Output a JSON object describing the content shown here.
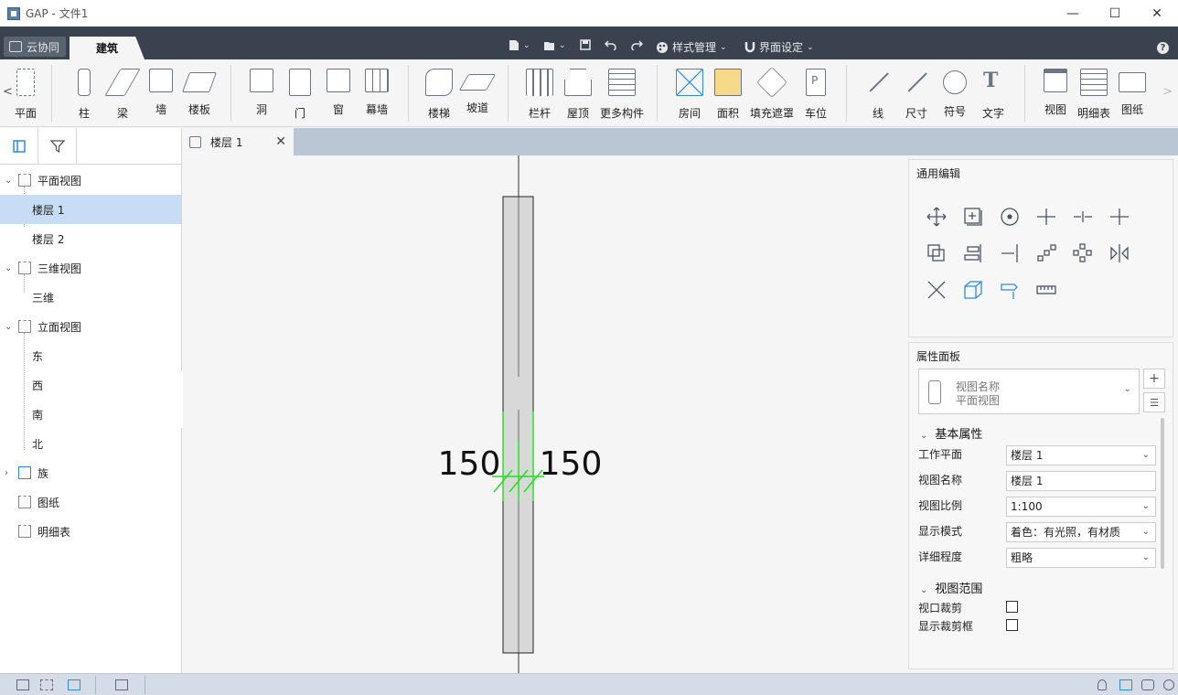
{
  "window": {
    "title": "GAP - 文件1",
    "minimize": "—",
    "maximize": "☐",
    "close": "✕"
  },
  "menubar": {
    "cloud_label": "云协同",
    "active_tab": "建筑",
    "style_manage": "样式管理",
    "ui_settings": "界面设定",
    "help": "?"
  },
  "ribbon": {
    "scroll_left": "<",
    "scroll_right": ">",
    "items": [
      {
        "label": "平面",
        "icon": "plan-icon"
      },
      {
        "label": "柱",
        "icon": "column-icon"
      },
      {
        "label": "梁",
        "icon": "beam-icon"
      },
      {
        "label": "墙",
        "icon": "wall-icon"
      },
      {
        "label": "楼板",
        "icon": "floor-slab-icon"
      },
      {
        "label": "洞",
        "icon": "opening-icon"
      },
      {
        "label": "门",
        "icon": "door-icon"
      },
      {
        "label": "窗",
        "icon": "window-icon"
      },
      {
        "label": "幕墙",
        "icon": "curtain-wall-icon"
      },
      {
        "label": "楼梯",
        "icon": "stairs-icon"
      },
      {
        "label": "坡道",
        "icon": "ramp-icon"
      },
      {
        "label": "栏杆",
        "icon": "railing-icon"
      },
      {
        "label": "屋顶",
        "icon": "roof-icon"
      },
      {
        "label": "更多构件",
        "icon": "more-components-icon"
      },
      {
        "label": "房间",
        "icon": "room-icon"
      },
      {
        "label": "面积",
        "icon": "area-icon"
      },
      {
        "label": "填充遮罩",
        "icon": "fill-mask-icon"
      },
      {
        "label": "车位",
        "icon": "parking-icon"
      },
      {
        "label": "线",
        "icon": "line-icon"
      },
      {
        "label": "尺寸",
        "icon": "dimension-icon"
      },
      {
        "label": "符号",
        "icon": "symbol-icon"
      },
      {
        "label": "文字",
        "icon": "text-icon"
      },
      {
        "label": "视图",
        "icon": "view-icon"
      },
      {
        "label": "明细表",
        "icon": "schedule-icon"
      },
      {
        "label": "图纸",
        "icon": "sheet-icon"
      }
    ]
  },
  "tree": {
    "nodes": [
      {
        "label": "平面视图",
        "level": 0,
        "caret": "⌄"
      },
      {
        "label": "楼层 1",
        "level": 1,
        "selected": true
      },
      {
        "label": "楼层 2",
        "level": 1
      },
      {
        "label": "三维视图",
        "level": 0,
        "caret": "⌄"
      },
      {
        "label": "三维",
        "level": 1
      },
      {
        "label": "立面视图",
        "level": 0,
        "caret": "⌄"
      },
      {
        "label": "东",
        "level": 1
      },
      {
        "label": "西",
        "level": 1
      },
      {
        "label": "南",
        "level": 1
      },
      {
        "label": "北",
        "level": 1
      },
      {
        "label": "族",
        "level": 0,
        "caret": "›"
      },
      {
        "label": "图纸",
        "level": 0
      },
      {
        "label": "明细表",
        "level": 0
      }
    ]
  },
  "document_tab": {
    "label": "楼层 1",
    "close": "✕"
  },
  "canvas": {
    "dim_left": "150",
    "dim_right": "150",
    "dim_color": "#22dd22"
  },
  "edit_panel": {
    "title": "通用编辑"
  },
  "properties": {
    "title": "属性面板",
    "type_line1": "视图名称",
    "type_line2": "平面视图",
    "section_basic": "基本属性",
    "section_range": "视图范围",
    "rows": [
      {
        "label": "工作平面",
        "value": "楼层 1",
        "dropdown": true
      },
      {
        "label": "视图名称",
        "value": "楼层 1",
        "dropdown": false
      },
      {
        "label": "视图比例",
        "value": "1:100",
        "dropdown": true
      },
      {
        "label": "显示模式",
        "value": "着色：有光照，有材质",
        "dropdown": true
      },
      {
        "label": "详细程度",
        "value": "粗略",
        "dropdown": true
      }
    ],
    "checks": [
      {
        "label": "视口裁剪"
      },
      {
        "label": "显示裁剪框"
      }
    ]
  },
  "colors": {
    "accent": "#2f8cd6",
    "tabbar": "#39424e",
    "selection": "#c7dcf5"
  }
}
